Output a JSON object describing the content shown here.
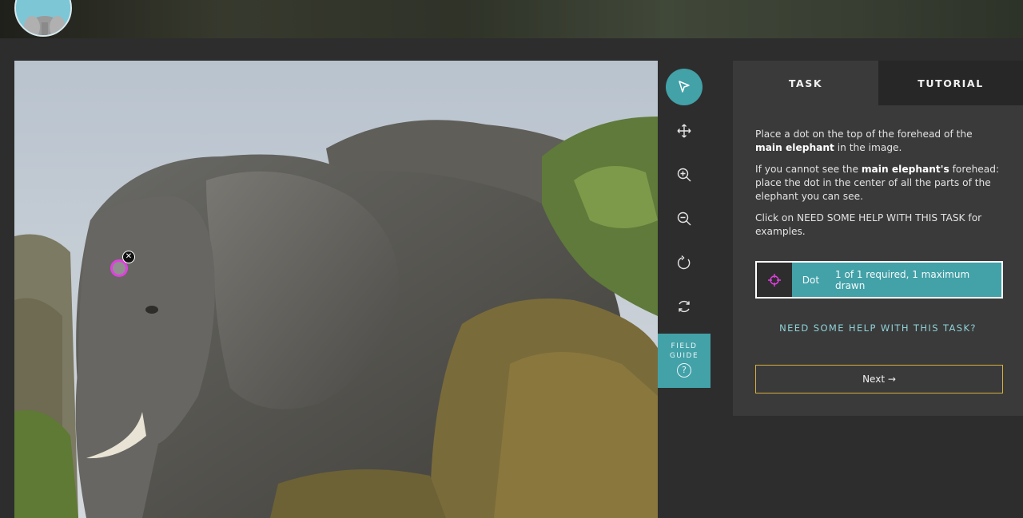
{
  "tabs": {
    "task": "TASK",
    "tutorial": "TUTORIAL"
  },
  "instructions": {
    "p1_pre": "Place a dot on the top of the forehead of the ",
    "p1_bold": "main elephant",
    "p1_post": " in the image.",
    "p2_pre": "If you cannot see the ",
    "p2_bold": "main elephant's",
    "p2_post": " forehead: place the dot in the center of all the parts of the elephant you can see.",
    "p3": "Click on NEED SOME HELP WITH THIS TASK for examples."
  },
  "dot_tool": {
    "name": "Dot",
    "count": "1 of 1 required, 1 maximum drawn",
    "icon": "crosshair-icon",
    "color": "#e040e0"
  },
  "help_link": "NEED SOME HELP WITH THIS TASK?",
  "next_button": "Next →",
  "field_guide": {
    "line1": "FIELD",
    "line2": "GUIDE",
    "icon_glyph": "?"
  },
  "toolbar": {
    "tools": [
      "pointer-icon",
      "move-icon",
      "zoom-in-icon",
      "zoom-out-icon",
      "rotate-icon",
      "reset-icon"
    ]
  },
  "mark": {
    "delete_glyph": "✕"
  },
  "colors": {
    "accent": "#43a1a8",
    "next_border": "#d7b03d",
    "panel": "#3a3a3a",
    "background": "#2d2d2d"
  }
}
